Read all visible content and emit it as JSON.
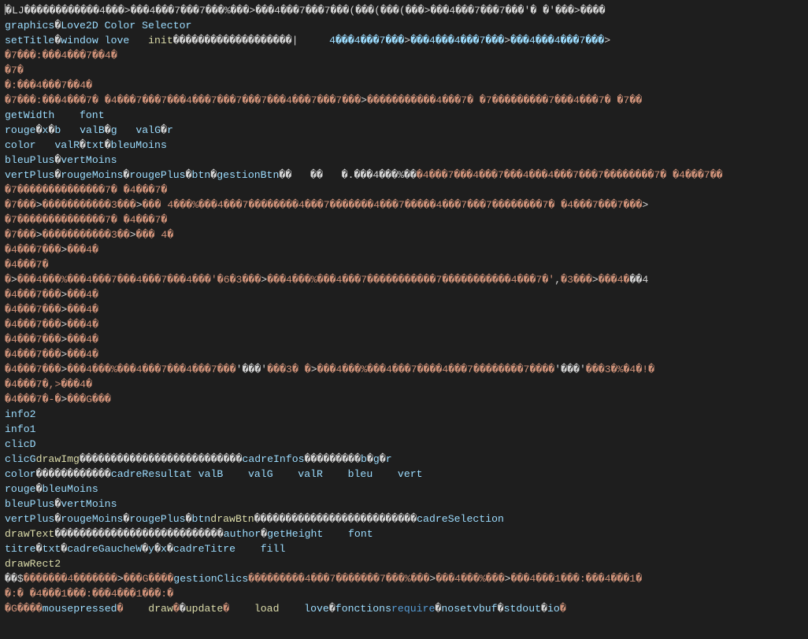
{
  "colors": {
    "bg": "#1e1e1e",
    "text": "#d4d4d4",
    "identifier": "#9cdcfe",
    "function": "#dcdcaa",
    "keyword": "#569cd6",
    "string": "#ce9178",
    "control": "#c586c0"
  },
  "lines": [
    {
      "segments": [
        {
          "cls": "tx",
          "t": "�LJ������������4���>���4���7���7���%���>���4���7���7���(���(���(���>���4���7���7���'� �'���>����"
        }
      ]
    },
    {
      "segments": [
        {
          "cls": "id",
          "t": "graphics"
        },
        {
          "cls": "tx",
          "t": "�"
        },
        {
          "cls": "id",
          "t": "Love2D Color Selector"
        }
      ]
    },
    {
      "segments": [
        {
          "cls": "id",
          "t": "setTitle"
        },
        {
          "cls": "tx",
          "t": "�"
        },
        {
          "cls": "id",
          "t": "window"
        },
        {
          "cls": "tx",
          "t": " "
        },
        {
          "cls": "id",
          "t": "love"
        },
        {
          "cls": "tx",
          "t": "   "
        },
        {
          "cls": "fn",
          "t": "init"
        },
        {
          "cls": "tx",
          "t": "�������������������|     "
        },
        {
          "cls": "id",
          "t": "4���4���7���"
        },
        {
          "cls": "tx",
          "t": ">"
        },
        {
          "cls": "id",
          "t": "���4���4���7���"
        },
        {
          "cls": "tx",
          "t": ">"
        },
        {
          "cls": "id",
          "t": "���4���4���7���"
        },
        {
          "cls": "tx",
          "t": ">"
        }
      ]
    },
    {
      "segments": [
        {
          "cls": "str",
          "t": "�7���:���4���7��4�"
        }
      ]
    },
    {
      "segments": [
        {
          "cls": "str",
          "t": "�7�"
        }
      ]
    },
    {
      "segments": [
        {
          "cls": "str",
          "t": "�:���4���7��4�"
        }
      ]
    },
    {
      "segments": [
        {
          "cls": "str",
          "t": "�7���:���4���7� �4���7���7���4���7���7���7���4���7���7���"
        },
        {
          "cls": "tx",
          "t": ">"
        },
        {
          "cls": "str",
          "t": "�����������4���7� �7���������7���4���7� �7��"
        }
      ]
    },
    {
      "segments": [
        {
          "cls": "id",
          "t": "getWidth"
        },
        {
          "cls": "tx",
          "t": "    "
        },
        {
          "cls": "id",
          "t": "font"
        }
      ]
    },
    {
      "segments": [
        {
          "cls": "id",
          "t": "rouge"
        },
        {
          "cls": "tx",
          "t": "�"
        },
        {
          "cls": "id",
          "t": "x"
        },
        {
          "cls": "tx",
          "t": "�"
        },
        {
          "cls": "id",
          "t": "b"
        },
        {
          "cls": "tx",
          "t": "   "
        },
        {
          "cls": "id",
          "t": "valB"
        },
        {
          "cls": "tx",
          "t": "�"
        },
        {
          "cls": "id",
          "t": "g"
        },
        {
          "cls": "tx",
          "t": "   "
        },
        {
          "cls": "id",
          "t": "valG"
        },
        {
          "cls": "tx",
          "t": "�"
        },
        {
          "cls": "id",
          "t": "r"
        }
      ]
    },
    {
      "segments": [
        {
          "cls": "id",
          "t": "color"
        },
        {
          "cls": "tx",
          "t": "   "
        },
        {
          "cls": "id",
          "t": "valR"
        },
        {
          "cls": "tx",
          "t": "�"
        },
        {
          "cls": "id",
          "t": "txt"
        },
        {
          "cls": "tx",
          "t": "�"
        },
        {
          "cls": "id",
          "t": "bleuMoins"
        }
      ]
    },
    {
      "segments": [
        {
          "cls": "id",
          "t": "bleuPlus"
        },
        {
          "cls": "tx",
          "t": "�"
        },
        {
          "cls": "id",
          "t": "vertMoins"
        }
      ]
    },
    {
      "segments": [
        {
          "cls": "id",
          "t": "vertPlus"
        },
        {
          "cls": "tx",
          "t": "�"
        },
        {
          "cls": "id",
          "t": "rougeMoins"
        },
        {
          "cls": "tx",
          "t": "�"
        },
        {
          "cls": "id",
          "t": "rougePlus"
        },
        {
          "cls": "tx",
          "t": "�"
        },
        {
          "cls": "id",
          "t": "btn"
        },
        {
          "cls": "tx",
          "t": "�"
        },
        {
          "cls": "id",
          "t": "gestionBtn"
        },
        {
          "cls": "tx",
          "t": "��   ��   "
        },
        {
          "cls": "tx",
          "t": "�.���4���%��"
        },
        {
          "cls": "str",
          "t": "�4���7���4���7���4���4���7���7��������7� �4���7��"
        }
      ]
    },
    {
      "segments": [
        {
          "cls": "str",
          "t": "�7��������������7� �4���7�"
        }
      ]
    },
    {
      "segments": [
        {
          "cls": "str",
          "t": "�7���"
        },
        {
          "cls": "tx",
          "t": ">"
        },
        {
          "cls": "str",
          "t": "�����������3���"
        },
        {
          "cls": "tx",
          "t": ">"
        },
        {
          "cls": "str",
          "t": "��� 4���%��"
        },
        {
          "cls": "str",
          "t": "�4���7��������4���7�������4���7�����4���7���7��������7� �4���7���7���"
        },
        {
          "cls": "tx",
          "t": ">"
        }
      ]
    },
    {
      "segments": [
        {
          "cls": "str",
          "t": "�7��������������7� �4���7�"
        }
      ]
    },
    {
      "segments": [
        {
          "cls": "str",
          "t": "�7���"
        },
        {
          "cls": "tx",
          "t": ">"
        },
        {
          "cls": "str",
          "t": "�����������3��"
        },
        {
          "cls": "tx",
          "t": ">"
        },
        {
          "cls": "str",
          "t": "��� 4�"
        }
      ]
    },
    {
      "segments": [
        {
          "cls": "str",
          "t": "�4���7���"
        },
        {
          "cls": "tx",
          "t": ">"
        },
        {
          "cls": "str",
          "t": "���4�"
        }
      ]
    },
    {
      "segments": [
        {
          "cls": "str",
          "t": "�4���7�"
        }
      ]
    },
    {
      "segments": [
        {
          "cls": "str",
          "t": "�"
        },
        {
          "cls": "tx",
          "t": ">"
        },
        {
          "cls": "str",
          "t": "���4���%��"
        },
        {
          "cls": "str",
          "t": "�4���7���4���7���4���'�6�3���"
        },
        {
          "cls": "tx",
          "t": ">"
        },
        {
          "cls": "str",
          "t": "���4���%���4���7�����������7�����������4���7�'"
        },
        {
          "cls": "tx",
          "t": ","
        },
        {
          "cls": "str",
          "t": "�3���"
        },
        {
          "cls": "tx",
          "t": ">"
        },
        {
          "cls": "str",
          "t": "���4�"
        },
        {
          "cls": "tx",
          "t": "��4"
        }
      ]
    },
    {
      "segments": [
        {
          "cls": "str",
          "t": "�4���7���"
        },
        {
          "cls": "tx",
          "t": ">"
        },
        {
          "cls": "str",
          "t": "���4�"
        }
      ]
    },
    {
      "segments": [
        {
          "cls": "str",
          "t": "�4���7���"
        },
        {
          "cls": "tx",
          "t": ">"
        },
        {
          "cls": "str",
          "t": "���4�"
        }
      ]
    },
    {
      "segments": [
        {
          "cls": "str",
          "t": "�4���7���"
        },
        {
          "cls": "tx",
          "t": ">"
        },
        {
          "cls": "str",
          "t": "���4"
        },
        {
          "cls": "str",
          "t": "�"
        }
      ]
    },
    {
      "segments": [
        {
          "cls": "str",
          "t": "�4���7���"
        },
        {
          "cls": "tx",
          "t": ">"
        },
        {
          "cls": "str",
          "t": "���4�"
        }
      ]
    },
    {
      "segments": [
        {
          "cls": "str",
          "t": "�4���7���"
        },
        {
          "cls": "tx",
          "t": ">"
        },
        {
          "cls": "str",
          "t": "���4�"
        }
      ]
    },
    {
      "segments": [
        {
          "cls": "str",
          "t": "�4���7���"
        },
        {
          "cls": "tx",
          "t": ">"
        },
        {
          "cls": "str",
          "t": "���4���%��"
        },
        {
          "cls": "str",
          "t": "�4���7���4���7���"
        },
        {
          "cls": "tx",
          "t": "'���'"
        },
        {
          "cls": "str",
          "t": "���3� �"
        },
        {
          "cls": "tx",
          "t": ">"
        },
        {
          "cls": "str",
          "t": "���4���%��"
        },
        {
          "cls": "str",
          "t": "�4���7����4���7��������7����"
        },
        {
          "cls": "tx",
          "t": "'���'"
        },
        {
          "cls": "str",
          "t": "���3�%�4�!�"
        }
      ]
    },
    {
      "segments": [
        {
          "cls": "str",
          "t": "�4���7�,>"
        },
        {
          "cls": "str",
          "t": "���4�"
        }
      ]
    },
    {
      "segments": [
        {
          "cls": "str",
          "t": "�4���7�-�"
        },
        {
          "cls": "tx",
          "t": ">"
        },
        {
          "cls": "str",
          "t": "���G���"
        }
      ]
    },
    {
      "segments": [
        {
          "cls": "id",
          "t": "info2"
        }
      ]
    },
    {
      "segments": [
        {
          "cls": "id",
          "t": "info1"
        }
      ]
    },
    {
      "segments": [
        {
          "cls": "id",
          "t": "clicD"
        }
      ]
    },
    {
      "segments": [
        {
          "cls": "id",
          "t": "clicG"
        },
        {
          "cls": "fn",
          "t": "drawImg"
        },
        {
          "cls": "tx",
          "t": "��������������������������"
        },
        {
          "cls": "id",
          "t": "cadreInfos"
        },
        {
          "cls": "tx",
          "t": "���������"
        },
        {
          "cls": "id",
          "t": "b"
        },
        {
          "cls": "tx",
          "t": "�"
        },
        {
          "cls": "id",
          "t": "g"
        },
        {
          "cls": "tx",
          "t": "�"
        },
        {
          "cls": "id",
          "t": "r"
        }
      ]
    },
    {
      "segments": [
        {
          "cls": "id",
          "t": "color"
        },
        {
          "cls": "tx",
          "t": "������������"
        },
        {
          "cls": "id",
          "t": "cadreResultat"
        },
        {
          "cls": "tx",
          "t": " "
        },
        {
          "cls": "id",
          "t": "valB"
        },
        {
          "cls": "tx",
          "t": "    "
        },
        {
          "cls": "id",
          "t": "valG"
        },
        {
          "cls": "tx",
          "t": "    "
        },
        {
          "cls": "id",
          "t": "valR"
        },
        {
          "cls": "tx",
          "t": "    "
        },
        {
          "cls": "id",
          "t": "bleu"
        },
        {
          "cls": "tx",
          "t": "    "
        },
        {
          "cls": "id",
          "t": "vert"
        }
      ]
    },
    {
      "segments": [
        {
          "cls": "id",
          "t": "rouge"
        },
        {
          "cls": "tx",
          "t": "�"
        },
        {
          "cls": "id",
          "t": "bleuMoins"
        }
      ]
    },
    {
      "segments": [
        {
          "cls": "id",
          "t": "bleuPlus"
        },
        {
          "cls": "tx",
          "t": "�"
        },
        {
          "cls": "id",
          "t": "vertMoins"
        }
      ]
    },
    {
      "segments": [
        {
          "cls": "id",
          "t": "vertPlus"
        },
        {
          "cls": "tx",
          "t": "�"
        },
        {
          "cls": "id",
          "t": "rougeMoins"
        },
        {
          "cls": "tx",
          "t": "�"
        },
        {
          "cls": "id",
          "t": "rougePlus"
        },
        {
          "cls": "tx",
          "t": "�"
        },
        {
          "cls": "id",
          "t": "btn"
        },
        {
          "cls": "fn",
          "t": "drawBtn"
        },
        {
          "cls": "tx",
          "t": "��������������������������"
        },
        {
          "cls": "id",
          "t": "cadreSelection"
        }
      ]
    },
    {
      "segments": [
        {
          "cls": "fn",
          "t": "drawText"
        },
        {
          "cls": "tx",
          "t": "���������������������������"
        },
        {
          "cls": "id",
          "t": "author"
        },
        {
          "cls": "tx",
          "t": "�"
        },
        {
          "cls": "id",
          "t": "getHeight"
        },
        {
          "cls": "tx",
          "t": "    "
        },
        {
          "cls": "id",
          "t": "font"
        }
      ]
    },
    {
      "segments": [
        {
          "cls": "id",
          "t": "titre"
        },
        {
          "cls": "tx",
          "t": "�"
        },
        {
          "cls": "id",
          "t": "txt"
        },
        {
          "cls": "tx",
          "t": "�"
        },
        {
          "cls": "id",
          "t": "cadreGauche"
        },
        {
          "cls": "id",
          "t": "W"
        },
        {
          "cls": "tx",
          "t": "�"
        },
        {
          "cls": "id",
          "t": "y"
        },
        {
          "cls": "tx",
          "t": "�"
        },
        {
          "cls": "id",
          "t": "x"
        },
        {
          "cls": "tx",
          "t": "�"
        },
        {
          "cls": "id",
          "t": "cadreTitre"
        },
        {
          "cls": "tx",
          "t": "    "
        },
        {
          "cls": "id",
          "t": "fill"
        }
      ]
    },
    {
      "segments": [
        {
          "cls": "fn",
          "t": "drawRect2"
        }
      ]
    },
    {
      "segments": [
        {
          "cls": "tx",
          "t": "��$"
        },
        {
          "cls": "str",
          "t": "�������4�������"
        },
        {
          "cls": "tx",
          "t": ">"
        },
        {
          "cls": "str",
          "t": "���G����"
        },
        {
          "cls": "id",
          "t": "gestionClics"
        },
        {
          "cls": "str",
          "t": "���������4���7�������7���%���"
        },
        {
          "cls": "tx",
          "t": ">"
        },
        {
          "cls": "str",
          "t": "���4���%���"
        },
        {
          "cls": "tx",
          "t": ">"
        },
        {
          "cls": "str",
          "t": "���4���1���:���4���1�"
        }
      ]
    },
    {
      "segments": [
        {
          "cls": "str",
          "t": "�:� �4���1���:���4���1���:�"
        }
      ]
    },
    {
      "segments": [
        {
          "cls": "str",
          "t": "�G����"
        },
        {
          "cls": "id",
          "t": "mousepressed"
        },
        {
          "cls": "str",
          "t": "�"
        },
        {
          "cls": "tx",
          "t": "    "
        },
        {
          "cls": "fn",
          "t": "draw"
        },
        {
          "cls": "str",
          "t": "�"
        },
        {
          "cls": "tx",
          "t": "�"
        },
        {
          "cls": "fn",
          "t": "update"
        },
        {
          "cls": "str",
          "t": "�"
        },
        {
          "cls": "tx",
          "t": "    "
        },
        {
          "cls": "fn",
          "t": "load"
        },
        {
          "cls": "tx",
          "t": "    "
        },
        {
          "cls": "id",
          "t": "love"
        },
        {
          "cls": "tx",
          "t": "�"
        },
        {
          "cls": "id",
          "t": "fonctions"
        },
        {
          "cls": "kw",
          "t": "require"
        },
        {
          "cls": "tx",
          "t": "�"
        },
        {
          "cls": "id",
          "t": "no"
        },
        {
          "cls": "id",
          "t": "setvbuf"
        },
        {
          "cls": "tx",
          "t": "�"
        },
        {
          "cls": "id",
          "t": "stdout"
        },
        {
          "cls": "tx",
          "t": "�"
        },
        {
          "cls": "id",
          "t": "io"
        },
        {
          "cls": "str",
          "t": "�"
        }
      ]
    }
  ]
}
